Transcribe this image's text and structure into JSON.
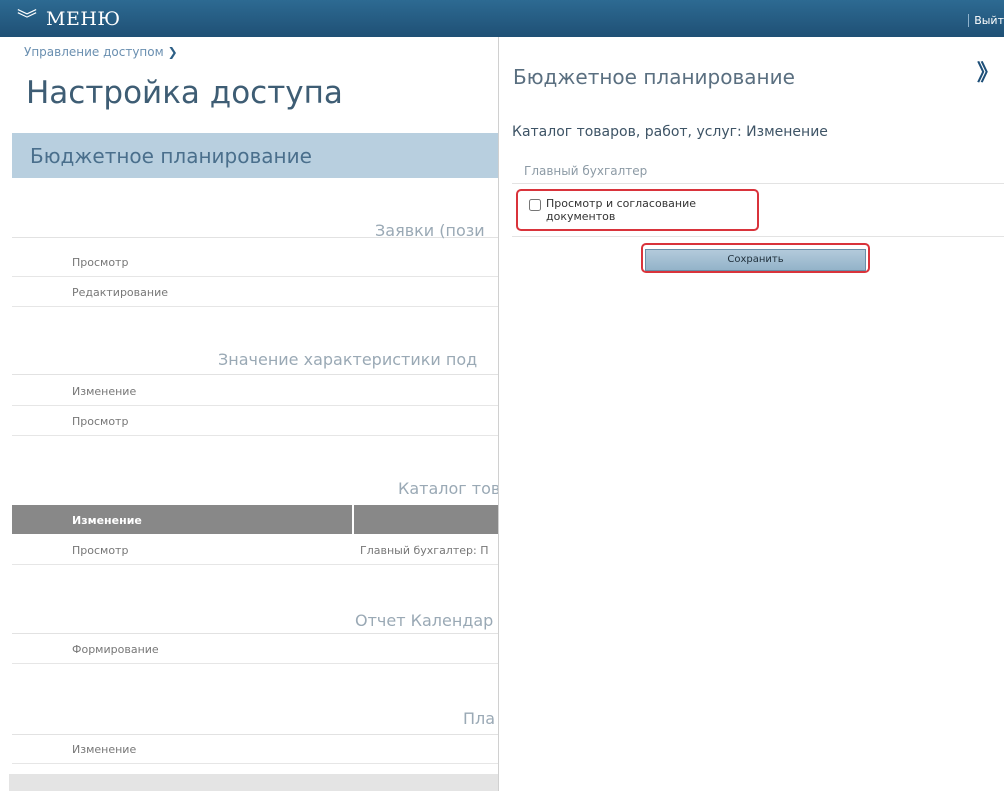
{
  "topbar": {
    "menu_label": "МЕНЮ",
    "logout_label": "Выйт"
  },
  "background_page": {
    "breadcrumb": "Управление доступом",
    "title": "Настройка доступа",
    "section": "Бюджетное планирование",
    "groups": [
      {
        "title": "Заявки (пози",
        "rows": [
          {
            "label": "Просмотр",
            "value": ""
          },
          {
            "label": "Редактирование",
            "value": ""
          }
        ]
      },
      {
        "title": "Значение характеристики под",
        "rows": [
          {
            "label": "Изменение",
            "value": ""
          },
          {
            "label": "Просмотр",
            "value": ""
          }
        ]
      },
      {
        "title": "Каталог тов",
        "rows": [
          {
            "label": "Изменение",
            "value": "",
            "highlighted": true
          },
          {
            "label": "Просмотр",
            "value": "Главный бухгалтер: П"
          }
        ]
      },
      {
        "title": "Отчет Календар",
        "rows": [
          {
            "label": "Формирование",
            "value": ""
          }
        ]
      },
      {
        "title": "Пла",
        "rows": [
          {
            "label": "Изменение",
            "value": ""
          }
        ]
      }
    ]
  },
  "panel": {
    "title": "Бюджетное планирование",
    "close_icon": "double-chevron-right-icon",
    "subtitle": "Каталог товаров, работ, услуг: Изменение",
    "role": "Главный бухгалтер",
    "permission_label": "Просмотр и согласование документов",
    "permission_checked": false,
    "save_label": "Сохранить"
  },
  "colors": {
    "topbar": "#2d6a92",
    "banner": "#b8cfdf",
    "highlight_row": "#888888",
    "annotation": "#d9333b"
  }
}
